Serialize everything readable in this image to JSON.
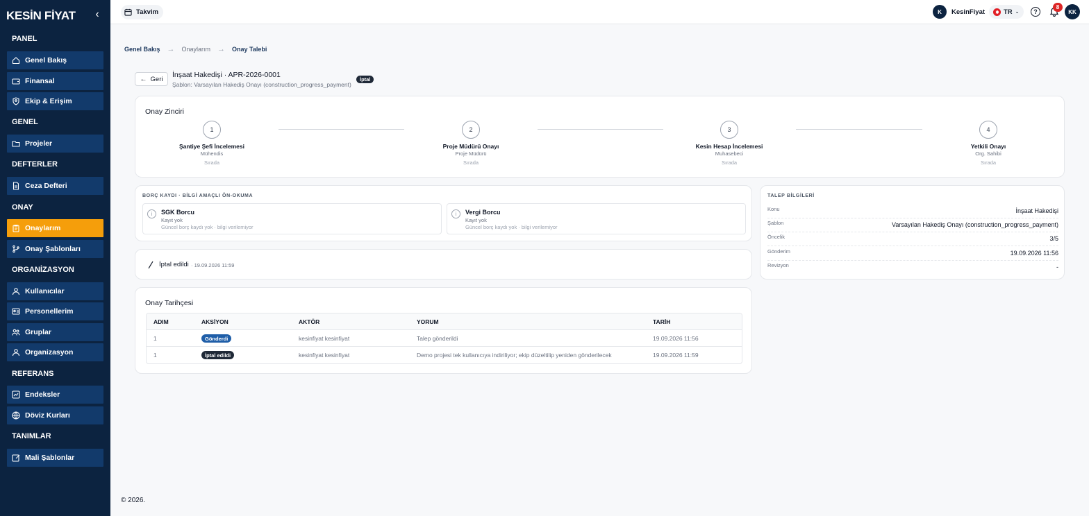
{
  "app": {
    "logo": "KESİN FİYAT"
  },
  "sidebar": {
    "sections": [
      {
        "title": "PANEL",
        "items": [
          {
            "label": "Genel Bakış",
            "icon": "home-icon"
          },
          {
            "label": "Finansal",
            "icon": "wallet-icon"
          },
          {
            "label": "Ekip & Erişim",
            "icon": "shield-user-icon"
          }
        ]
      },
      {
        "title": "GENEL",
        "items": [
          {
            "label": "Projeler",
            "icon": "folder-icon"
          }
        ]
      },
      {
        "title": "DEFTERLER",
        "items": [
          {
            "label": "Ceza Defteri",
            "icon": "document-icon"
          }
        ]
      },
      {
        "title": "ONAY",
        "items": [
          {
            "label": "Onaylarım",
            "icon": "clipboard-icon",
            "active": true
          },
          {
            "label": "Onay Şablonları",
            "icon": "git-branch-icon"
          }
        ]
      },
      {
        "title": "ORGANİZASYON",
        "items": [
          {
            "label": "Kullanıcılar",
            "icon": "user-icon"
          },
          {
            "label": "Personellerim",
            "icon": "id-card-icon"
          },
          {
            "label": "Gruplar",
            "icon": "users-icon"
          },
          {
            "label": "Organizasyon",
            "icon": "org-icon"
          }
        ]
      },
      {
        "title": "REFERANS",
        "items": [
          {
            "label": "Endeksler",
            "icon": "chart-icon"
          },
          {
            "label": "Döviz Kurları",
            "icon": "globe-icon"
          }
        ]
      },
      {
        "title": "TANIMLAR",
        "items": [
          {
            "label": "Mali Şablonlar",
            "icon": "edit-icon"
          }
        ]
      }
    ]
  },
  "header": {
    "calendar_label": "Takvim",
    "org_initial": "K",
    "org_name": "KesinFiyat",
    "language": "TR",
    "notification_count": "8",
    "user_initials": "KK"
  },
  "breadcrumb": [
    "Genel Bakış",
    "Onaylarım",
    "Onay Talebi"
  ],
  "page": {
    "back_label": "Geri",
    "title": "İnşaat Hakedişi · APR-2026-0001",
    "subtitle": "Şablon: Varsayılan Hakediş Onayı (construction_progress_payment)",
    "status": "İptal"
  },
  "chain": {
    "title": "Onay Zinciri",
    "steps": [
      {
        "number": "1",
        "name": "Şantiye Şefi İncelemesi",
        "role": "Mühendis",
        "status": "Sırada"
      },
      {
        "number": "2",
        "name": "Proje Müdürü Onayı",
        "role": "Proje Müdürü",
        "status": "Sırada"
      },
      {
        "number": "3",
        "name": "Kesin Hesap İncelemesi",
        "role": "Muhasebeci",
        "status": "Sırada"
      },
      {
        "number": "4",
        "name": "Yetkili Onayı",
        "role": "Org. Sahibi",
        "status": "Sırada"
      }
    ]
  },
  "debt": {
    "label": "BORÇ KAYDI · BİLGİ AMAÇLI ÖN-OKUMA",
    "items": [
      {
        "name": "SGK Borcu",
        "line1": "Kayıt yok",
        "line2": "Güncel borç kaydı yok · bilgi verilemiyor"
      },
      {
        "name": "Vergi Borcu",
        "line1": "Kayıt yok",
        "line2": "Güncel borç kaydı yok · bilgi verilemiyor"
      }
    ]
  },
  "request_info": {
    "label": "TALEP BİLGİLERİ",
    "rows": [
      {
        "key": "Konu",
        "value": "İnşaat Hakedişi"
      },
      {
        "key": "Şablon",
        "value": "Varsayılan Hakediş Onayı (construction_progress_payment)"
      },
      {
        "key": "Öncelik",
        "value": "3/5"
      },
      {
        "key": "Gönderim",
        "value": "19.09.2026 11:56"
      },
      {
        "key": "Revizyon",
        "value": "-"
      }
    ]
  },
  "cancellation": {
    "text": "İptal edildi",
    "date": "· 19.09.2026 11:59"
  },
  "history": {
    "title": "Onay Tarihçesi",
    "columns": [
      "ADIM",
      "AKSİYON",
      "AKTÖR",
      "YORUM",
      "TARİH"
    ],
    "rows": [
      {
        "step": "1",
        "action": "Gönderdi",
        "action_color": "#1f5ea8",
        "actor": "kesinfiyat kesinfiyat",
        "comment": "Talep gönderildi",
        "date": "19.09.2026 11:56"
      },
      {
        "step": "1",
        "action": "İptal edildi",
        "action_color": "#1f2937",
        "actor": "kesinfiyat kesinfiyat",
        "comment": "Demo projesi tek kullanıcıya indiriliyor; ekip düzeltilip yeniden gönderilecek",
        "date": "19.09.2026 11:59"
      }
    ]
  },
  "footer": {
    "text": "© 2026."
  },
  "colors": {
    "sidebar_bg": "#0c2340",
    "nav_item_bg": "#123a6b",
    "active": "#f59e0b"
  }
}
